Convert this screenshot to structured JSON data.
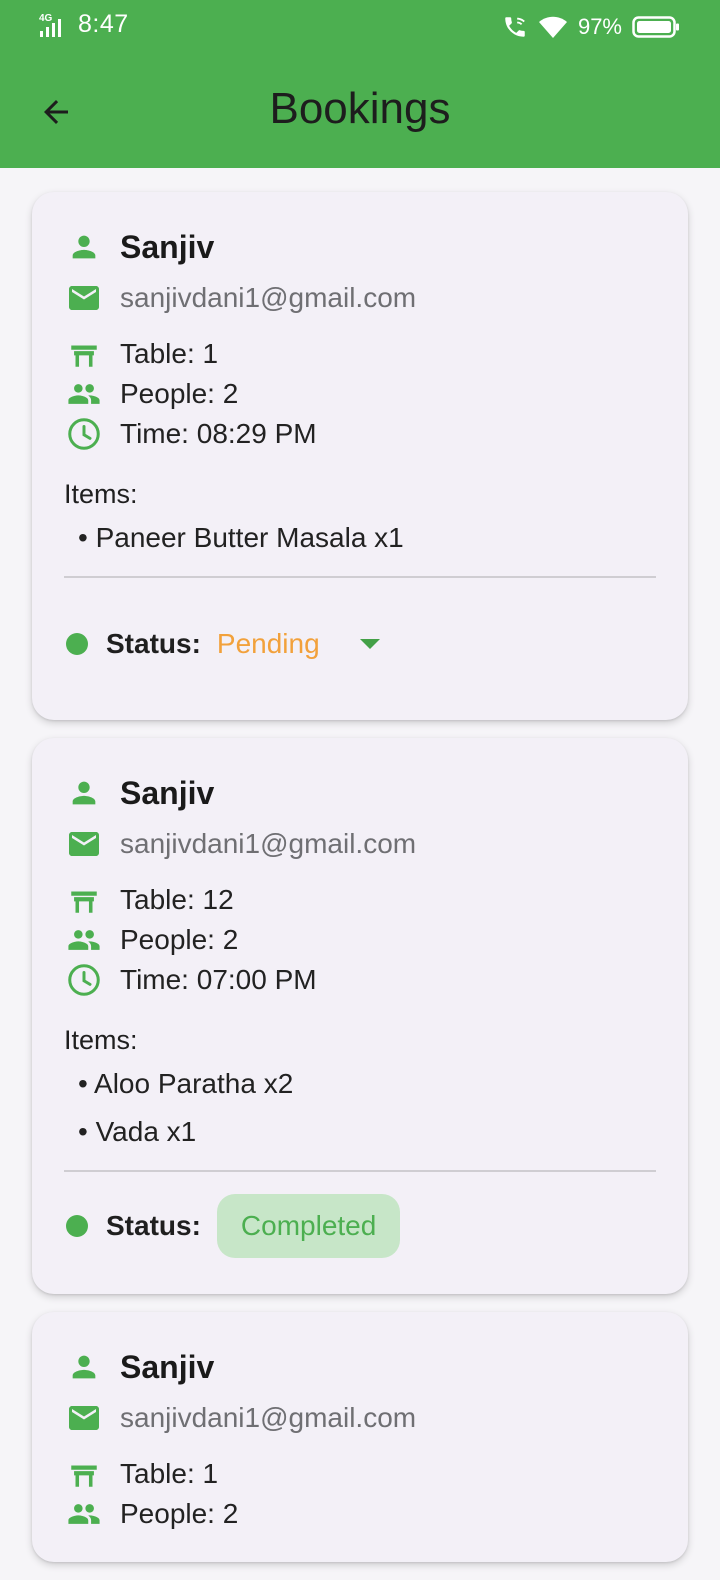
{
  "status_bar": {
    "network": "4G",
    "time": "8:47",
    "battery": "97%"
  },
  "appbar": {
    "title": "Bookings"
  },
  "labels": {
    "items": "Items:",
    "status": "Status:"
  },
  "colors": {
    "primary": "#4caf50",
    "pending": "#f2a13b",
    "completed_bg": "#c7e6c8"
  },
  "bookings": [
    {
      "name": "Sanjiv",
      "email": "sanjivdani1@gmail.com",
      "table": "Table: 1",
      "people": "People: 2",
      "time": "Time: 08:29 PM",
      "items": [
        "• Paneer Butter Masala x1"
      ],
      "status": "Pending"
    },
    {
      "name": "Sanjiv",
      "email": "sanjivdani1@gmail.com",
      "table": "Table: 12",
      "people": "People: 2",
      "time": "Time: 07:00 PM",
      "items": [
        "• Aloo Paratha x2",
        "• Vada x1"
      ],
      "status": "Completed"
    },
    {
      "name": "Sanjiv",
      "email": "sanjivdani1@gmail.com",
      "table": "Table: 1",
      "people": "People: 2"
    }
  ]
}
